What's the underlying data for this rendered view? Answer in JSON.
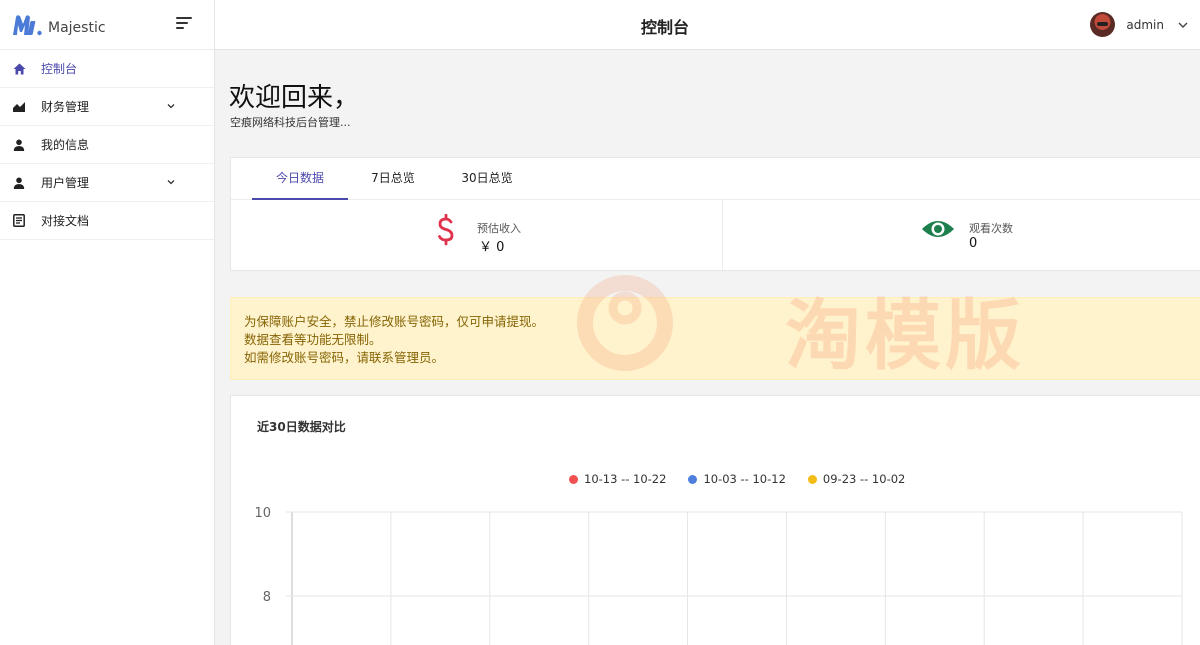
{
  "brand": {
    "name": "Majestic"
  },
  "header": {
    "title": "控制台",
    "user": "admin"
  },
  "sidebar": {
    "items": [
      {
        "label": "控制台",
        "icon": "home-icon",
        "active": true,
        "has_submenu": false
      },
      {
        "label": "财务管理",
        "icon": "chart-area-icon",
        "active": false,
        "has_submenu": true
      },
      {
        "label": "我的信息",
        "icon": "user-icon",
        "active": false,
        "has_submenu": false
      },
      {
        "label": "用户管理",
        "icon": "user-icon",
        "active": false,
        "has_submenu": true
      },
      {
        "label": "对接文档",
        "icon": "document-icon",
        "active": false,
        "has_submenu": false
      }
    ]
  },
  "welcome": {
    "title": "欢迎回来，",
    "subtitle": "空痕网络科技后台管理..."
  },
  "tabs": [
    {
      "label": "今日数据",
      "active": true
    },
    {
      "label": "7日总览",
      "active": false
    },
    {
      "label": "30日总览",
      "active": false
    }
  ],
  "stats": [
    {
      "label": "预估收入",
      "value": "￥ 0",
      "icon": "dollar-icon",
      "color": "#e0324b"
    },
    {
      "label": "观看次数",
      "value": "0",
      "icon": "eye-icon",
      "color": "#1e7f4e"
    }
  ],
  "notice": {
    "lines": [
      "为保障账户安全，禁止修改账号密码，仅可申请提现。",
      "数据查看等功能无限制。",
      "如需修改账号密码，请联系管理员。"
    ]
  },
  "watermark": {
    "text": "淘模版"
  },
  "chart_data": {
    "type": "line",
    "title": "近30日数据对比",
    "series": [
      {
        "name": "10-13 -- 10-22",
        "color": "#f0504f",
        "values": []
      },
      {
        "name": "10-03 -- 10-12",
        "color": "#4f7fdd",
        "values": []
      },
      {
        "name": "09-23 -- 10-02",
        "color": "#f4bc16",
        "values": []
      }
    ],
    "y_ticks": [
      10,
      8
    ],
    "ylim": [
      0,
      10
    ],
    "grid": true,
    "legend_position": "top"
  },
  "colors": {
    "accent": "#4b49ac"
  }
}
